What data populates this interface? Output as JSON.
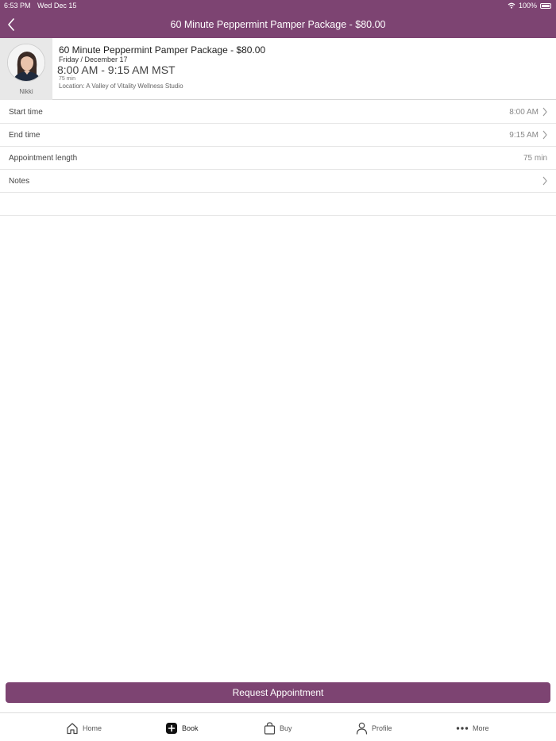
{
  "status_bar": {
    "time": "6:53 PM",
    "date": "Wed Dec 15",
    "battery": "100%"
  },
  "nav": {
    "title": "60 Minute Peppermint Pamper Package - $80.00",
    "back_icon": "chevron-left-icon"
  },
  "appointment": {
    "provider_name": "Nikki",
    "service_title": "60 Minute Peppermint Pamper Package - $80.00",
    "date": "Friday / December 17",
    "time_range": "8:00 AM - 9:15 AM MST",
    "length_short": "75 min",
    "location": "Location: A Valley of Vitality Wellness Studio"
  },
  "rows": {
    "start": {
      "label": "Start time",
      "value": "8:00 AM"
    },
    "end": {
      "label": "End time",
      "value": "9:15 AM"
    },
    "length": {
      "label": "Appointment length",
      "value": "75 min"
    },
    "notes": {
      "label": "Notes",
      "value": ""
    }
  },
  "cta": {
    "label": "Request Appointment"
  },
  "tabs": [
    {
      "label": "Home",
      "icon": "home-icon"
    },
    {
      "label": "Book",
      "icon": "plus-square-icon",
      "active": true
    },
    {
      "label": "Buy",
      "icon": "shopping-bag-icon"
    },
    {
      "label": "Profile",
      "icon": "person-icon"
    },
    {
      "label": "More",
      "icon": "ellipsis-icon"
    }
  ],
  "colors": {
    "brand": "#7d4472",
    "background": "#ffffff",
    "avatar_panel": "#e8e8e8"
  }
}
